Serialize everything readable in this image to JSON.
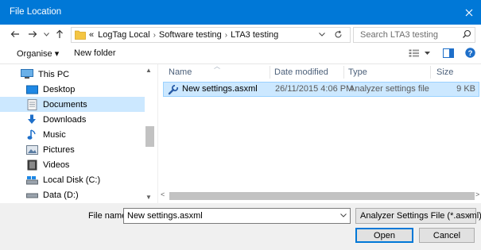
{
  "window": {
    "title": "File Location"
  },
  "address": {
    "crumbs": [
      "«",
      "LogTag Local",
      "Software testing",
      "LTA3 testing"
    ],
    "search_placeholder": "Search LTA3 testing"
  },
  "toolbar": {
    "organise_label": "Organise ▾",
    "new_folder_label": "New folder"
  },
  "nav": {
    "items": [
      {
        "label": "This PC",
        "icon": "computer-icon",
        "selected": false
      },
      {
        "label": "Desktop",
        "icon": "desktop-icon",
        "selected": false
      },
      {
        "label": "Documents",
        "icon": "documents-icon",
        "selected": true
      },
      {
        "label": "Downloads",
        "icon": "download-icon",
        "selected": false
      },
      {
        "label": "Music",
        "icon": "music-icon",
        "selected": false
      },
      {
        "label": "Pictures",
        "icon": "pictures-icon",
        "selected": false
      },
      {
        "label": "Videos",
        "icon": "videos-icon",
        "selected": false
      },
      {
        "label": "Local Disk (C:)",
        "icon": "local-disk-icon",
        "selected": false
      },
      {
        "label": "Data (D:)",
        "icon": "drive-icon",
        "selected": false
      }
    ]
  },
  "files": {
    "columns": {
      "name": "Name",
      "date": "Date modified",
      "type": "Type",
      "size": "Size"
    },
    "rows": [
      {
        "name": "New settings.asxml",
        "date": "26/11/2015 4:06 PM",
        "type": "Analyzer settings file",
        "size": "9 KB",
        "selected": true
      }
    ]
  },
  "footer": {
    "filename_label": "File name:",
    "filename_value": "New settings.asxml",
    "filter_value": "Analyzer Settings File (*.asxml)",
    "open_label": "Open",
    "cancel_label": "Cancel"
  },
  "colors": {
    "accent": "#0078d7",
    "selection": "#cce8ff",
    "selection_border": "#99d1ff",
    "folder": "#f4c542"
  }
}
